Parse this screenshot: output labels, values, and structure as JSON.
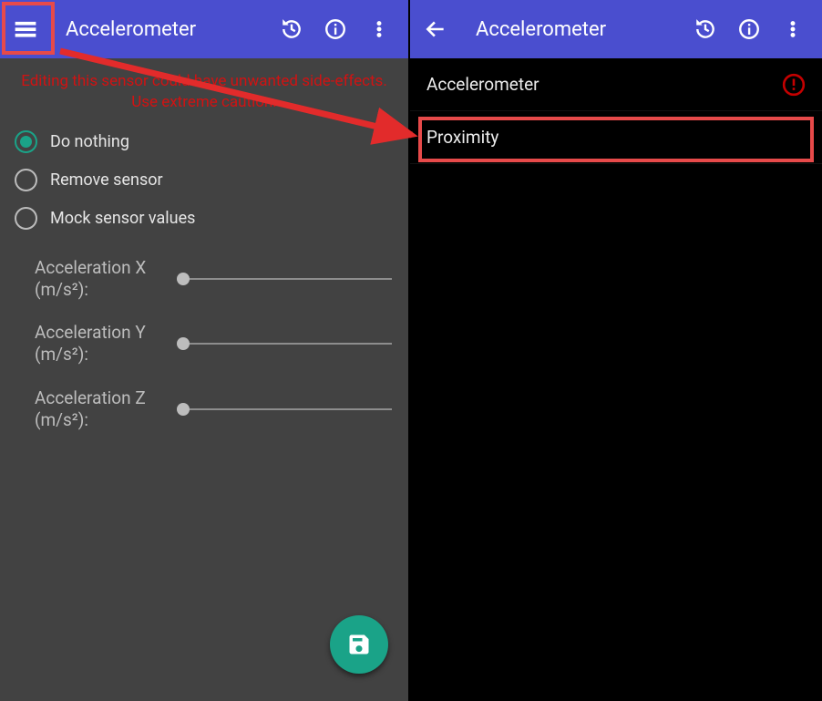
{
  "left": {
    "title": "Accelerometer",
    "warning_line1": "Editing this sensor could have unwanted side-effects.",
    "warning_line2": "Use extreme caution.",
    "options": {
      "do_nothing": "Do nothing",
      "remove": "Remove sensor",
      "mock": "Mock sensor values"
    },
    "sliders": {
      "x_label": "Acceleration X (m/s²):",
      "y_label": "Acceleration Y (m/s²):",
      "z_label": "Acceleration Z (m/s²):"
    }
  },
  "right": {
    "title": "Accelerometer",
    "items": {
      "accel": "Accelerometer",
      "prox": "Proximity"
    }
  },
  "icons": {
    "menu": "menu-icon",
    "back": "back-icon",
    "history": "history-icon",
    "info": "info-icon",
    "overflow": "overflow-icon",
    "save": "save-icon",
    "alert": "alert-icon"
  }
}
